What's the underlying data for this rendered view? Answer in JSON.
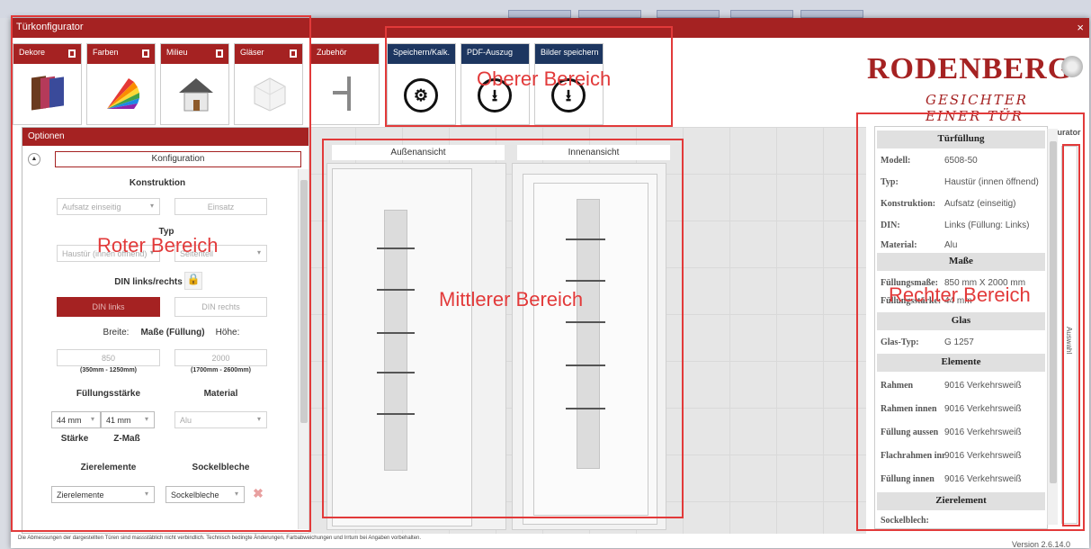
{
  "window": {
    "title": "Türkonfigurator",
    "close": "×"
  },
  "tiles": {
    "dekore": "Dekore",
    "farben": "Farben",
    "milieu": "Milieu",
    "glaeser": "Gläser",
    "zubehoer": "Zubehör",
    "speichern": "Speichern/Kalk.",
    "pdf": "PDF-Auszug",
    "bilder": "Bilder speichern"
  },
  "brand": {
    "name": "RODENBERG",
    "slogan": "GESICHTER EINER TÜR",
    "sub": "FBS-Konfigurator"
  },
  "options": {
    "header": "Optionen",
    "konfiguration": "Konfiguration",
    "konstruktion_label": "Konstruktion",
    "konstruktion_value": "Aufsatz einseitig",
    "einsatz": "Einsatz",
    "typ_label": "Typ",
    "typ_value": "Haustür (innen öffnend)",
    "seitenteil": "Seitenteil",
    "din_label": "DIN links/rechts",
    "din_links": "DIN links",
    "din_rechts": "DIN rechts",
    "breite_label": "Breite:",
    "masse_label": "Maße (Füllung)",
    "hoehe_label": "Höhe:",
    "breite_value": "850",
    "hoehe_value": "2000",
    "breite_range": "(350mm - 1250mm)",
    "hoehe_range": "(1700mm - 2600mm)",
    "fuellungsstaerke_label": "Füllungsstärke",
    "material_label": "Material",
    "staerke_value": "44 mm",
    "zmass_value": "41 mm",
    "material_value": "Alu",
    "staerke_label": "Stärke",
    "zmass_label": "Z-Maß",
    "zierelemente_label": "Zierelemente",
    "sockelbleche_label": "Sockelbleche",
    "zierelemente_value": "Zierelemente",
    "sockelbleche_value": "Sockelbleche"
  },
  "views": {
    "aussen": "Außenansicht",
    "innen": "Innenansicht"
  },
  "info": {
    "tuerfuellung": "Türfüllung",
    "modell_k": "Modell:",
    "modell_v": "6508-50",
    "typ_k": "Typ:",
    "typ_v": "Haustür (innen öffnend)",
    "konstruktion_k": "Konstruktion:",
    "konstruktion_v": "Aufsatz (einseitig)",
    "din_k": "DIN:",
    "din_v": "Links (Füllung: Links)",
    "material_k": "Material:",
    "material_v": "Alu",
    "masse": "Maße",
    "fmasse_k": "Füllungsmaße:",
    "fmasse_v": "850 mm X 2000 mm",
    "fstaerke_k": "Füllungsstärke:",
    "fstaerke_v": "44 mm",
    "glas": "Glas",
    "glastyp_k": "Glas-Typ:",
    "glastyp_v": "G 1257",
    "elemente": "Elemente",
    "rahmen_k": "Rahmen",
    "rahmen_v": "9016 Verkehrsweiß",
    "rahmeninnen_k": "Rahmen innen",
    "rahmeninnen_v": "9016 Verkehrsweiß",
    "fuellungaussen_k": "Füllung aussen",
    "fuellungaussen_v": "9016 Verkehrsweiß",
    "flachrahmen_k": "Flachrahmen inr",
    "flachrahmen_v": "9016 Verkehrsweiß",
    "fuellunginnen_k": "Füllung innen",
    "fuellunginnen_v": "9016 Verkehrsweiß",
    "zierelement": "Zierelement",
    "sockelblech_k": "Sockelblech:"
  },
  "auswahl": "Auswahl",
  "footer": "Die Abmessungen der dargestellten Türen sind massstäblich nicht verbindlich. Technisch bedingte Änderungen, Farbabweichungen und Irrtum bei Angaben vorbehalten.",
  "version": "Version 2.6.14.0",
  "annotations": {
    "oben": "Oberer Bereich",
    "rot": "Roter Bereich",
    "mitte": "Mittlerer Bereich",
    "rechts": "Rechter Bereich"
  },
  "colors": {
    "brand_red": "#a52222",
    "navy": "#1d3660",
    "annotation": "#e23a3a"
  }
}
